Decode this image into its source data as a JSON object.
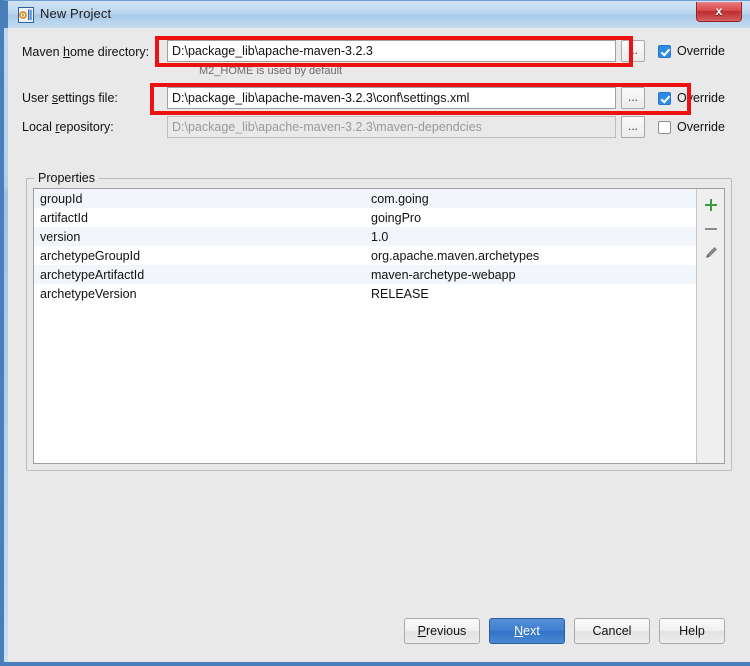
{
  "window": {
    "title": "New Project",
    "app_icon": "intellij-idea-icon",
    "close_label": "x"
  },
  "fields": [
    {
      "label_pre": "Maven ",
      "label_mnemonic": "h",
      "label_post": "ome directory:",
      "value": "D:\\package_lib\\apache-maven-3.2.3",
      "browse_label": "...",
      "override_label": "Override",
      "override_checked": true,
      "disabled": false,
      "hint": "M2_HOME is used by default"
    },
    {
      "label_pre": "User ",
      "label_mnemonic": "s",
      "label_post": "ettings file:",
      "value": "D:\\package_lib\\apache-maven-3.2.3\\conf\\settings.xml",
      "browse_label": "...",
      "override_label": "Override",
      "override_checked": true,
      "disabled": false,
      "hint": ""
    },
    {
      "label_pre": "Local ",
      "label_mnemonic": "r",
      "label_post": "epository:",
      "value": "D:\\package_lib\\apache-maven-3.2.3\\maven-dependcies",
      "browse_label": "...",
      "override_label": "Override",
      "override_checked": false,
      "disabled": true,
      "hint": ""
    }
  ],
  "properties": {
    "legend": "Properties",
    "rows": [
      {
        "key": "groupId",
        "value": "com.going"
      },
      {
        "key": "artifactId",
        "value": "goingPro"
      },
      {
        "key": "version",
        "value": "1.0"
      },
      {
        "key": "archetypeGroupId",
        "value": "org.apache.maven.archetypes"
      },
      {
        "key": "archetypeArtifactId",
        "value": "maven-archetype-webapp"
      },
      {
        "key": "archetypeVersion",
        "value": "RELEASE"
      }
    ],
    "toolbar": {
      "add_icon": "plus-icon",
      "remove_icon": "minus-icon",
      "edit_icon": "pencil-icon",
      "add_color": "#3c9e3c",
      "remove_color": "#8a8a8a",
      "edit_color": "#7b7b7b"
    }
  },
  "buttons": {
    "previous": {
      "pre": "",
      "mnemonic": "P",
      "post": "revious"
    },
    "next": {
      "pre": "",
      "mnemonic": "N",
      "post": "ext"
    },
    "cancel": {
      "pre": "Cancel",
      "mnemonic": "",
      "post": ""
    },
    "help": {
      "pre": "Help",
      "mnemonic": "",
      "post": ""
    }
  },
  "annotations": {
    "color": "#ee1111",
    "count": 2
  }
}
